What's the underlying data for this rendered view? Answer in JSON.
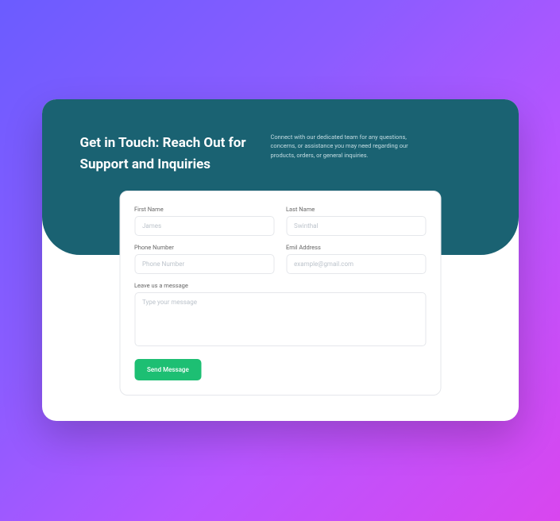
{
  "hero": {
    "heading": "Get in Touch: Reach Out for Support and Inquiries",
    "description": "Connect with our dedicated team for any questions, concerns, or assistance you may need regarding our products, orders, or general inquiries."
  },
  "form": {
    "firstName": {
      "label": "First Name",
      "placeholder": "James"
    },
    "lastName": {
      "label": "Last Name",
      "placeholder": "Swinthal"
    },
    "phone": {
      "label": "Phone Number",
      "placeholder": "Phone Number"
    },
    "email": {
      "label": "Emil Address",
      "placeholder": "example@gmail.com"
    },
    "message": {
      "label": "Leave us a message",
      "placeholder": "Type your message"
    },
    "submit": "Send Message"
  }
}
